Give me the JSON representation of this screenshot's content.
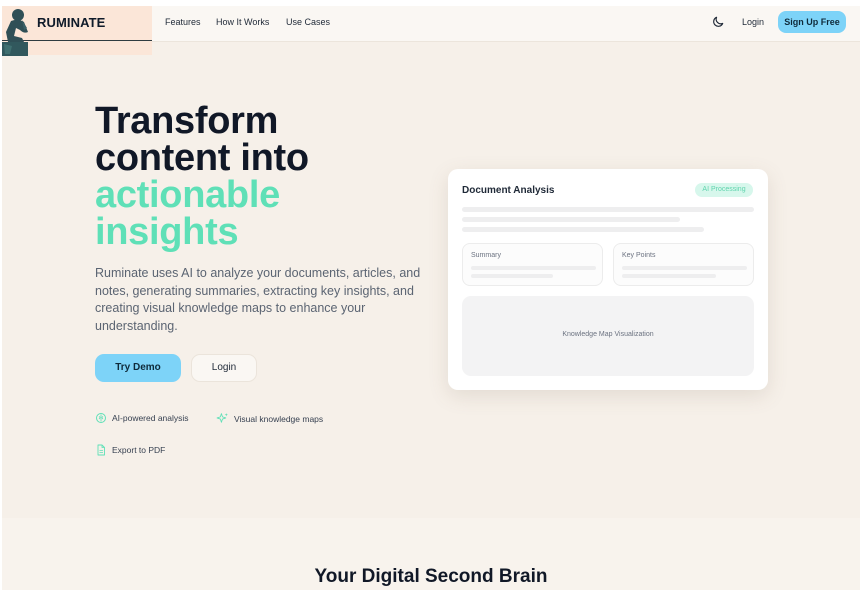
{
  "brand": {
    "name": "RUMINATE",
    "logo": "thinker-statue-icon"
  },
  "nav": {
    "links": [
      "Features",
      "How It Works",
      "Use Cases"
    ],
    "theme_icon": "moon-icon",
    "login": "Login",
    "signup": "Sign Up Free"
  },
  "hero": {
    "title_line1": "Transform",
    "title_line2": "content into",
    "title_accent1": "actionable",
    "title_accent2": "insights",
    "description": "Ruminate uses AI to analyze your documents, articles, and notes, generating summaries, extracting key insights, and creating visual knowledge maps to enhance your understanding.",
    "primary_button": "Try Demo",
    "secondary_button": "Login",
    "features": [
      {
        "label": "AI-powered analysis",
        "icon": "brain-icon"
      },
      {
        "label": "Visual knowledge maps",
        "icon": "sparkles-icon"
      },
      {
        "label": "Export to PDF",
        "icon": "document-icon"
      }
    ]
  },
  "preview_card": {
    "title": "Document Analysis",
    "badge": "AI Processing",
    "summary_label": "Summary",
    "keypoints_label": "Key Points",
    "map_label": "Knowledge Map Visualization"
  },
  "section": {
    "title": "Your Digital Second Brain"
  },
  "colors": {
    "accent": "#5fe0b7",
    "button": "#7dd3f8",
    "background": "#f6f0e9"
  }
}
